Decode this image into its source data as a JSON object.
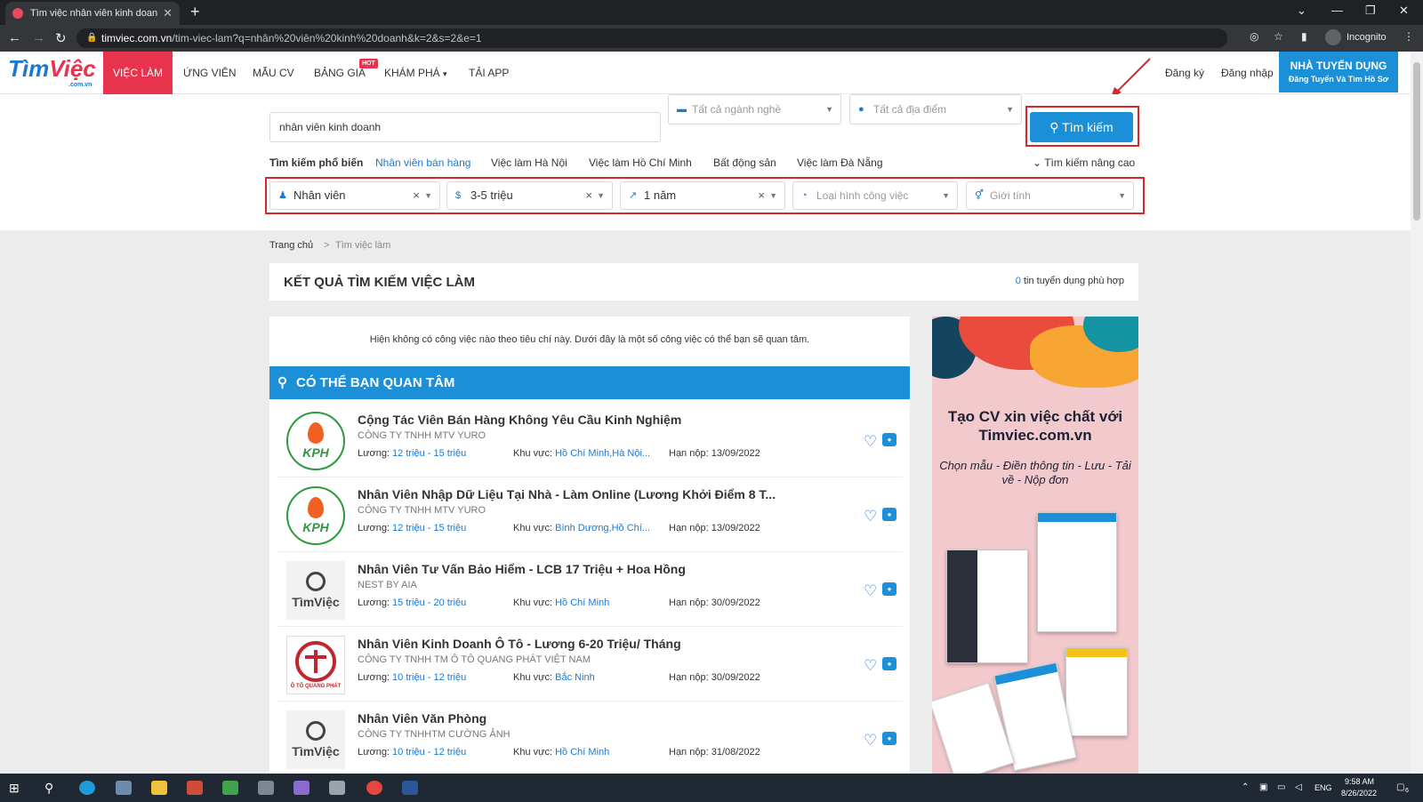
{
  "browser": {
    "tab_title": "Tìm việc nhân viên kinh doanh m",
    "url_host": "timviec.com.vn",
    "url_path": "/tim-viec-lam?q=nhân%20viên%20kinh%20doanh&k=2&s=2&e=1",
    "incognito_label": "Incognito"
  },
  "header": {
    "logo_main": "Tìm",
    "logo_accent": "Việc",
    "logo_sub": ".com.vn",
    "nav": [
      "VIỆC LÀM",
      "ỨNG VIÊN",
      "MẪU CV",
      "BẢNG GIÁ",
      "KHÁM PHÁ",
      "TẢI APP"
    ],
    "hot_badge": "HOT",
    "register": "Đăng ký",
    "login": "Đăng nhập",
    "employer_title": "NHÀ TUYỂN DỤNG",
    "employer_sub": "Đăng Tuyển Và Tìm Hồ Sơ"
  },
  "search": {
    "keyword": "nhân viên kinh doanh",
    "industry_placeholder": "Tất cả ngành nghề",
    "location_placeholder": "Tất cả địa điểm",
    "button": "Tìm kiếm",
    "popular_label": "Tìm kiếm phổ biến",
    "popular": [
      "Nhân viên bán hàng",
      "Việc làm Hà Nội",
      "Việc làm Hồ Chí Minh",
      "Bất động sản",
      "Việc làm Đà Nẵng"
    ],
    "advanced": "Tìm kiếm nâng cao",
    "filters": {
      "level": "Nhân viên",
      "salary": "3-5 triệu",
      "experience": "1 năm",
      "job_type_placeholder": "Loại hình công việc",
      "gender_placeholder": "Giới tính"
    }
  },
  "breadcrumb": {
    "home": "Trang chủ",
    "sep": ">",
    "current": "Tìm việc làm"
  },
  "results": {
    "title": "KẾT QUẢ TÌM KIẾM VIỆC LÀM",
    "count": "0",
    "count_suffix": " tin tuyển dụng phù hợp",
    "notice": "Hiện không có công việc nào theo tiêu chí này. Dưới đây là một số công việc có thể bạn sẽ quan tâm.",
    "interest_title": "CÓ THỂ BẠN QUAN TÂM"
  },
  "labels": {
    "salary": "Lương: ",
    "area": "Khu vực: ",
    "deadline": "Hạn nộp: "
  },
  "jobs": [
    {
      "title": "Cộng Tác Viên Bán Hàng Không Yêu Cầu Kinh Nghiệm",
      "company": "CÔNG TY TNHH MTV YURO",
      "salary": "12 triệu - 15 triệu",
      "area": "Hồ Chí Minh,Hà Nội...",
      "deadline": "13/09/2022",
      "logo": "KPH"
    },
    {
      "title": "Nhân Viên Nhập Dữ Liệu Tại Nhà - Làm Online (Lương Khởi Điểm 8 T...",
      "company": "CÔNG TY TNHH MTV YURO",
      "salary": "12 triệu - 15 triệu",
      "area": "Bình Dương,Hồ Chí...",
      "deadline": "13/09/2022",
      "logo": "KPH"
    },
    {
      "title": "Nhân Viên Tư Vấn Bảo Hiểm - LCB 17 Triệu + Hoa Hồng",
      "company": "NEST BY AIA",
      "salary": "15 triệu - 20 triệu",
      "area": "Hồ Chí Minh",
      "deadline": "30/09/2022",
      "logo": "TìmViệc"
    },
    {
      "title": "Nhân Viên Kinh Doanh Ô Tô - Lương 6-20 Triệu/ Tháng",
      "company": "CÔNG TY TNHH TM Ô TÔ QUANG PHÁT VIỆT NAM",
      "salary": "10 triệu - 12 triệu",
      "area": "Bắc Ninh",
      "deadline": "30/09/2022",
      "logo": "Ô TÔ QUANG PHÁT"
    },
    {
      "title": "Nhân Viên Văn Phòng",
      "company": "CÔNG TY TNHHTM CƯỜNG ẢNH",
      "salary": "10 triệu - 12 triệu",
      "area": "Hồ Chí Minh",
      "deadline": "31/08/2022",
      "logo": "TìmViệc"
    }
  ],
  "ad": {
    "title": "Tạo CV xin việc chất với Timviec.com.vn",
    "subtitle": "Chọn mẫu - Điền thông tin - Lưu - Tải về - Nộp đơn"
  },
  "taskbar": {
    "lang": "ENG",
    "time": "9:58 AM",
    "date": "8/26/2022",
    "notif": "6"
  },
  "colors": {
    "brand_blue": "#1b8fd8",
    "brand_red": "#e8334f",
    "highlight": "#d7262e"
  }
}
